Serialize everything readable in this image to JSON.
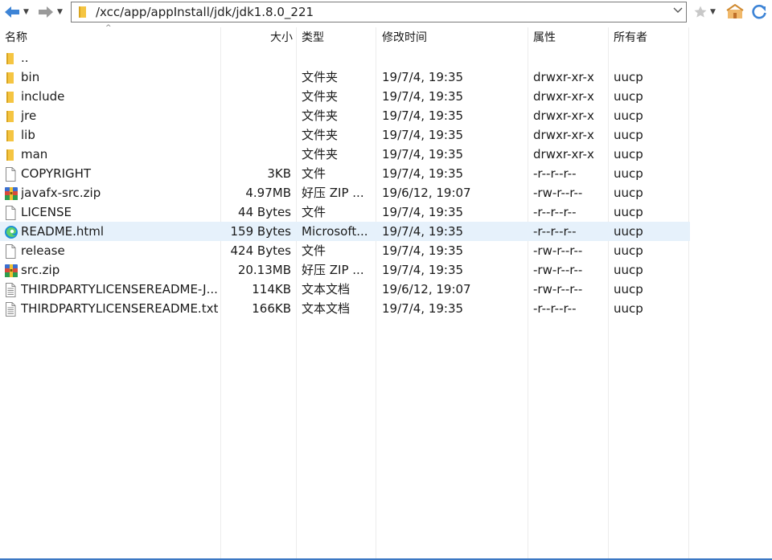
{
  "address": {
    "path": "/xcc/app/appInstall/jdk/jdk1.8.0_221"
  },
  "columns": {
    "name": "名称",
    "size": "大小",
    "type": "类型",
    "modified": "修改时间",
    "attributes": "属性",
    "owner": "所有者"
  },
  "files": [
    {
      "icon": "folder-icon",
      "name": "..",
      "size": "",
      "type": "",
      "modified": "",
      "perm": "",
      "owner": ""
    },
    {
      "icon": "folder-icon",
      "name": "bin",
      "size": "",
      "type": "文件夹",
      "modified": "19/7/4, 19:35",
      "perm": "drwxr-xr-x",
      "owner": "uucp"
    },
    {
      "icon": "folder-icon",
      "name": "include",
      "size": "",
      "type": "文件夹",
      "modified": "19/7/4, 19:35",
      "perm": "drwxr-xr-x",
      "owner": "uucp"
    },
    {
      "icon": "folder-icon",
      "name": "jre",
      "size": "",
      "type": "文件夹",
      "modified": "19/7/4, 19:35",
      "perm": "drwxr-xr-x",
      "owner": "uucp"
    },
    {
      "icon": "folder-icon",
      "name": "lib",
      "size": "",
      "type": "文件夹",
      "modified": "19/7/4, 19:35",
      "perm": "drwxr-xr-x",
      "owner": "uucp"
    },
    {
      "icon": "folder-icon",
      "name": "man",
      "size": "",
      "type": "文件夹",
      "modified": "19/7/4, 19:35",
      "perm": "drwxr-xr-x",
      "owner": "uucp"
    },
    {
      "icon": "file-icon",
      "name": "COPYRIGHT",
      "size": "3KB",
      "type": "文件",
      "modified": "19/7/4, 19:35",
      "perm": "-r--r--r--",
      "owner": "uucp"
    },
    {
      "icon": "zip-icon",
      "name": "javafx-src.zip",
      "size": "4.97MB",
      "type": "好压 ZIP ...",
      "modified": "19/6/12, 19:07",
      "perm": "-rw-r--r--",
      "owner": "uucp"
    },
    {
      "icon": "file-icon",
      "name": "LICENSE",
      "size": "44 Bytes",
      "type": "文件",
      "modified": "19/7/4, 19:35",
      "perm": "-r--r--r--",
      "owner": "uucp"
    },
    {
      "icon": "edge-icon",
      "name": "README.html",
      "size": "159 Bytes",
      "type": "Microsoft...",
      "modified": "19/7/4, 19:35",
      "perm": "-r--r--r--",
      "owner": "uucp",
      "selected": true
    },
    {
      "icon": "file-icon",
      "name": "release",
      "size": "424 Bytes",
      "type": "文件",
      "modified": "19/7/4, 19:35",
      "perm": "-rw-r--r--",
      "owner": "uucp"
    },
    {
      "icon": "zip-icon",
      "name": "src.zip",
      "size": "20.13MB",
      "type": "好压 ZIP ...",
      "modified": "19/7/4, 19:35",
      "perm": "-rw-r--r--",
      "owner": "uucp"
    },
    {
      "icon": "text-doc-icon",
      "name": "THIRDPARTYLICENSEREADME-J...",
      "size": "114KB",
      "type": "文本文档",
      "modified": "19/6/12, 19:07",
      "perm": "-rw-r--r--",
      "owner": "uucp"
    },
    {
      "icon": "text-doc-icon",
      "name": "THIRDPARTYLICENSEREADME.txt",
      "size": "166KB",
      "type": "文本文档",
      "modified": "19/7/4, 19:35",
      "perm": "-r--r--r--",
      "owner": "uucp"
    }
  ],
  "colors": {
    "selection": "#e6f1fb",
    "folder": "#f5c542",
    "back_arrow": "#3d84d6",
    "accent_line": "#3c78c3"
  }
}
